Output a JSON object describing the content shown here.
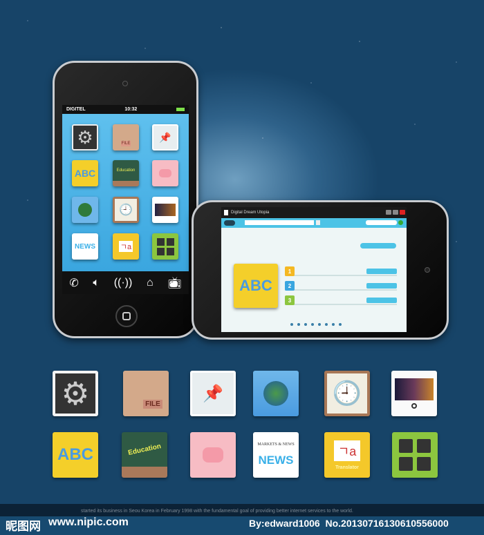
{
  "portrait_phone": {
    "carrier": "DIGITEL",
    "time": "10:32",
    "dock_icons": [
      "phone-icon",
      "speaker-icon",
      "signal-icon",
      "home-icon",
      "tv-icon"
    ]
  },
  "landscape_phone": {
    "window_title": "Digital Dream Utopia",
    "list_numbers": [
      "1",
      "2",
      "3"
    ]
  },
  "icons": {
    "file_label": "FILE",
    "education_label": "Education",
    "markets_label": "MARKETS & NEWS",
    "news_label": "NEWS",
    "translator_label": "Translator",
    "translator_glyph": "ㄱa"
  },
  "footer": {
    "tagline": "started its business in Seou Korea in February 1998 with the fundamental goal of providing better internet services to the world.",
    "site_logo": "昵图网",
    "site_url": "www.nipic.com",
    "credit": "By:edward1006  No.20130716130610556000"
  },
  "colors": {
    "screen_blue": "#4cb4e8",
    "accent_cyan": "#4cc3e6",
    "background": "#174468"
  }
}
